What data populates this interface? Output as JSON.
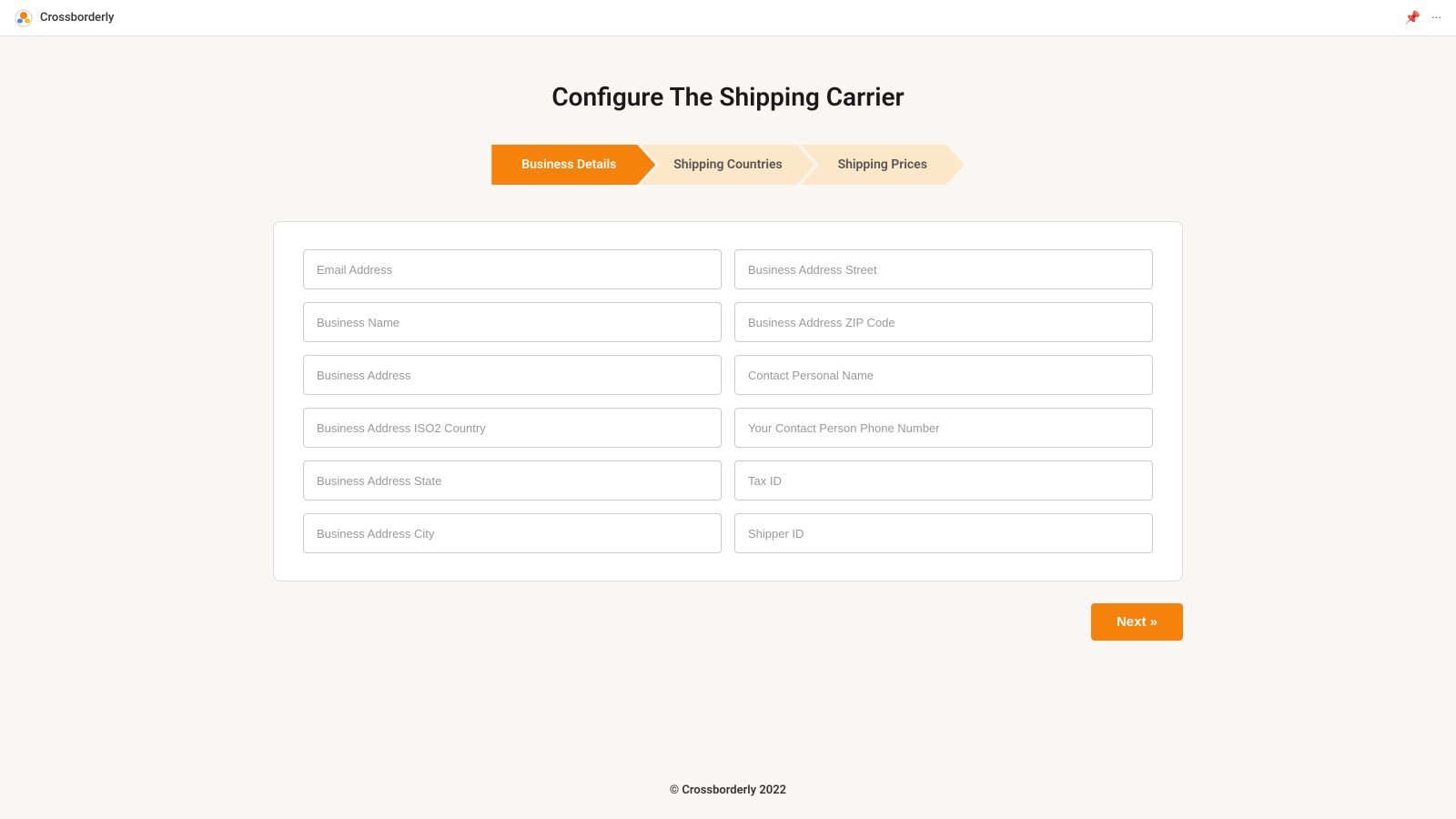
{
  "topbar": {
    "app_name": "Crossborderly",
    "pin_icon": "📌",
    "more_icon": "···"
  },
  "page": {
    "title": "Configure The Shipping Carrier",
    "footer": "© Crossborderly 2022"
  },
  "stepper": {
    "steps": [
      {
        "id": "business-details",
        "label": "Business Details",
        "active": true
      },
      {
        "id": "shipping-countries",
        "label": "Shipping Countries",
        "active": false
      },
      {
        "id": "shipping-prices",
        "label": "Shipping Prices",
        "active": false
      }
    ]
  },
  "form": {
    "fields_left": [
      {
        "id": "email-address",
        "placeholder": "Email Address"
      },
      {
        "id": "business-name",
        "placeholder": "Business Name"
      },
      {
        "id": "business-address",
        "placeholder": "Business Address"
      },
      {
        "id": "business-address-iso2-country",
        "placeholder": "Business Address ISO2 Country"
      },
      {
        "id": "business-address-state",
        "placeholder": "Business Address State"
      },
      {
        "id": "business-address-city",
        "placeholder": "Business Address City"
      }
    ],
    "fields_right": [
      {
        "id": "business-address-street",
        "placeholder": "Business Address Street"
      },
      {
        "id": "business-address-zip",
        "placeholder": "Business Address ZIP Code"
      },
      {
        "id": "contact-personal-name",
        "placeholder": "Contact Personal Name"
      },
      {
        "id": "contact-phone-number",
        "placeholder": "Your Contact Person Phone Number"
      },
      {
        "id": "tax-id",
        "placeholder": "Tax ID"
      },
      {
        "id": "shipper-id",
        "placeholder": "Shipper ID"
      }
    ]
  },
  "buttons": {
    "next_label": "Next »"
  }
}
